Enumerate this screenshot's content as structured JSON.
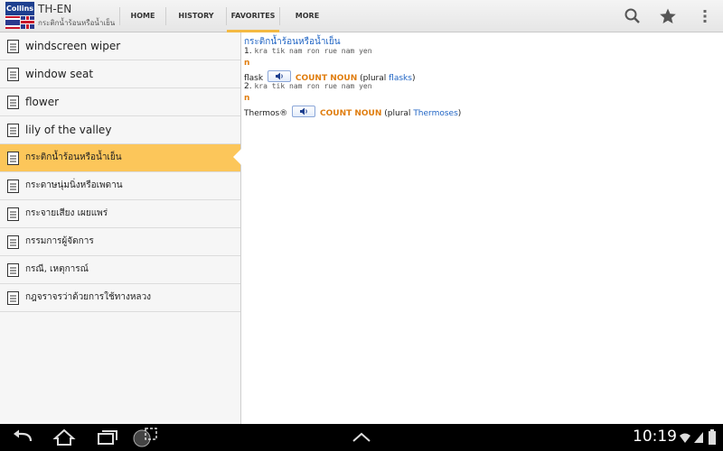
{
  "app": {
    "logo_text": "Collins",
    "title": "TH-EN",
    "subtitle": "กระติกน้ำร้อนหรือน้ำเย็น"
  },
  "tabs": [
    {
      "label": "HOME",
      "selected": false
    },
    {
      "label": "HISTORY",
      "selected": false
    },
    {
      "label": "FAVORITES",
      "selected": true
    },
    {
      "label": "MORE",
      "selected": false
    }
  ],
  "toolbar_icons": [
    "search-icon",
    "star-icon",
    "overflow-menu-icon"
  ],
  "list": [
    {
      "label": "windscreen wiper",
      "selected": false
    },
    {
      "label": "window seat",
      "selected": false
    },
    {
      "label": "flower",
      "selected": false
    },
    {
      "label": "lily of the valley",
      "selected": false
    },
    {
      "label": "กระติกน้ำร้อนหรือน้ำเย็น",
      "selected": true
    },
    {
      "label": "กระดาษนุ่มนิ่งหรือเพดาน",
      "selected": false
    },
    {
      "label": "กระจายเสียง เผยแพร่",
      "selected": false
    },
    {
      "label": "กรรมการผู้จัดการ",
      "selected": false
    },
    {
      "label": "กรณี, เหตุการณ์",
      "selected": false
    },
    {
      "label": "กฎจราจรว่าด้วยการใช้ทางหลวง",
      "selected": false
    }
  ],
  "entry": {
    "headword": "กระติกน้ำร้อนหรือน้ำเย็น",
    "senses": [
      {
        "number": "1.",
        "transliteration": "kra tik nam ron rue nam yen",
        "pos": "n",
        "word": "flask",
        "count_label": "COUNT NOUN",
        "plural_prefix": "(plural",
        "plural": "flasks",
        "plural_suffix": ")"
      },
      {
        "number": "2.",
        "transliteration": "kra tik nam ron rue nam yen",
        "pos": "n",
        "word": "Thermos®",
        "count_label": "COUNT NOUN",
        "plural_prefix": "(plural",
        "plural": "Thermoses",
        "plural_suffix": ")"
      }
    ]
  },
  "system_bar": {
    "time": "10:19",
    "icons": [
      "back-icon",
      "home-icon",
      "recent-apps-icon",
      "screenshot-icon",
      "up-arrow-icon",
      "wifi-icon",
      "signal-icon",
      "battery-icon"
    ]
  },
  "colors": {
    "accent": "#f4b942",
    "selected_row": "#fcc65a",
    "headword": "#1f64c4",
    "pos": "#e07e10"
  }
}
